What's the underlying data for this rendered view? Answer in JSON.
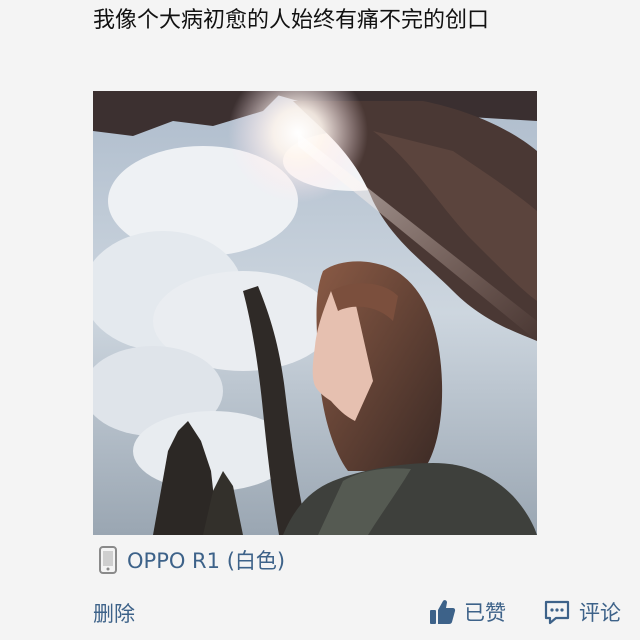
{
  "post": {
    "text": "我像个大病初愈的人始终有痛不完的创口",
    "photo_alt": "photo",
    "device": "OPPO R1 (白色)"
  },
  "actions": {
    "delete_label": "删除",
    "like_label": "已赞",
    "comment_label": "评论"
  },
  "icons": {
    "device": "phone-icon",
    "like": "thumbs-up-icon",
    "comment": "comment-bubble-icon"
  },
  "colors": {
    "link": "#3d6289",
    "text": "#111111",
    "background": "#f4f4f4"
  }
}
